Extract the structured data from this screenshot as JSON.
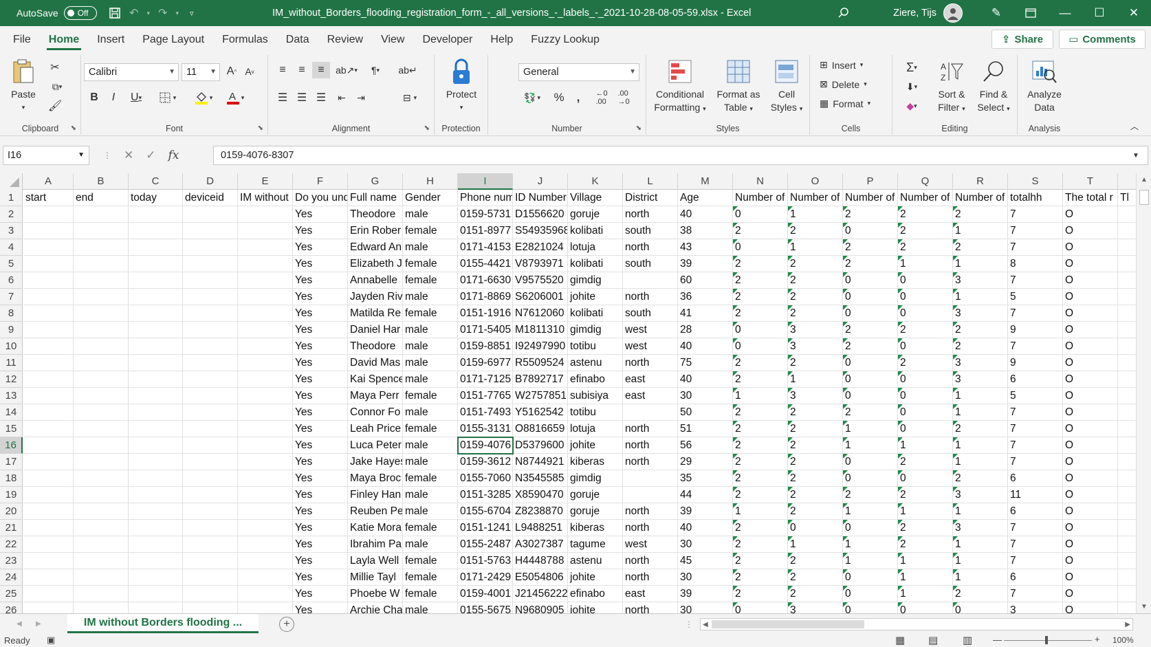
{
  "titlebar": {
    "autosave_label": "AutoSave",
    "autosave_state": "Off",
    "title": "IM_without_Borders_flooding_registration_form_-_all_versions_-_labels_-_2021-10-28-08-05-59.xlsx  -  Excel",
    "user": "Ziere, Tijs"
  },
  "tabs": [
    "File",
    "Home",
    "Insert",
    "Page Layout",
    "Formulas",
    "Data",
    "Review",
    "View",
    "Developer",
    "Help",
    "Fuzzy Lookup"
  ],
  "share_label": "Share",
  "comments_label": "Comments",
  "ribbon": {
    "clipboard": {
      "label": "Clipboard",
      "paste": "Paste"
    },
    "font": {
      "label": "Font",
      "name": "Calibri",
      "size": "11"
    },
    "alignment": {
      "label": "Alignment"
    },
    "protection": {
      "label": "Protection",
      "protect": "Protect"
    },
    "number": {
      "label": "Number",
      "format": "General"
    },
    "styles": {
      "label": "Styles",
      "conditional_1": "Conditional",
      "conditional_2": "Formatting",
      "format_table_1": "Format as",
      "format_table_2": "Table",
      "cell_styles_1": "Cell",
      "cell_styles_2": "Styles"
    },
    "cells": {
      "label": "Cells",
      "insert": "Insert",
      "delete": "Delete",
      "format": "Format"
    },
    "editing": {
      "label": "Editing",
      "sort_1": "Sort &",
      "sort_2": "Filter",
      "find_1": "Find &",
      "find_2": "Select"
    },
    "analysis": {
      "label": "Analysis",
      "analyze_1": "Analyze",
      "analyze_2": "Data"
    }
  },
  "formula_bar": {
    "name_box": "I16",
    "value": "0159-4076-8307"
  },
  "columns": [
    "A",
    "B",
    "C",
    "D",
    "E",
    "F",
    "G",
    "H",
    "I",
    "J",
    "K",
    "L",
    "M",
    "N",
    "O",
    "P",
    "Q",
    "R",
    "S",
    "T"
  ],
  "selected_column": "I",
  "selected_row": 16,
  "header_row": [
    "start",
    "end",
    "today",
    "deviceid",
    "IM without Borders flooding",
    "Do you understand",
    "Full name",
    "Gender",
    "Phone number",
    "ID Number",
    "Village",
    "District",
    "Age",
    "Number of",
    "Number of",
    "Number of",
    "Number of",
    "Number of",
    "totalhh",
    "The total r",
    "Tl"
  ],
  "rows": [
    [
      "Yes",
      "Theodore",
      "male",
      "0159-5731",
      "D1556620",
      "goruje",
      "north",
      "40",
      "0",
      "1",
      "2",
      "2",
      "2",
      "7",
      "O"
    ],
    [
      "Yes",
      "Erin Rober",
      "female",
      "0151-8977",
      "S54935968",
      "kolibati",
      "south",
      "38",
      "2",
      "2",
      "0",
      "2",
      "1",
      "7",
      "O"
    ],
    [
      "Yes",
      "Edward An",
      "male",
      "0171-4153",
      "E2821024",
      "lotuja",
      "north",
      "43",
      "0",
      "1",
      "2",
      "2",
      "2",
      "7",
      "O"
    ],
    [
      "Yes",
      "Elizabeth J",
      "female",
      "0155-4421",
      "V8793971",
      "kolibati",
      "south",
      "39",
      "2",
      "2",
      "2",
      "1",
      "1",
      "8",
      "O"
    ],
    [
      "Yes",
      "Annabelle",
      "female",
      "0171-6630",
      "V9575520",
      "gimdig",
      "",
      "60",
      "2",
      "2",
      "0",
      "0",
      "3",
      "7",
      "O"
    ],
    [
      "Yes",
      "Jayden Riv",
      "male",
      "0171-8869",
      "S6206001",
      "johite",
      "north",
      "36",
      "2",
      "2",
      "0",
      "0",
      "1",
      "5",
      "O"
    ],
    [
      "Yes",
      "Matilda Re",
      "female",
      "0151-1916",
      "N7612060",
      "kolibati",
      "south",
      "41",
      "2",
      "2",
      "0",
      "0",
      "3",
      "7",
      "O"
    ],
    [
      "Yes",
      "Daniel Har",
      "male",
      "0171-5405",
      "M1811310",
      "gimdig",
      "west",
      "28",
      "0",
      "3",
      "2",
      "2",
      "2",
      "9",
      "O"
    ],
    [
      "Yes",
      "Theodore",
      "male",
      "0159-8851",
      "I92497990",
      "totibu",
      "west",
      "40",
      "0",
      "3",
      "2",
      "0",
      "2",
      "7",
      "O"
    ],
    [
      "Yes",
      "David Mas",
      "male",
      "0159-6977",
      "R5509524",
      "astenu",
      "north",
      "75",
      "2",
      "2",
      "0",
      "2",
      "3",
      "9",
      "O"
    ],
    [
      "Yes",
      "Kai Spence",
      "male",
      "0171-7125",
      "B7892717",
      "efinabo",
      "east",
      "40",
      "2",
      "1",
      "0",
      "0",
      "3",
      "6",
      "O"
    ],
    [
      "Yes",
      "Maya Perr",
      "female",
      "0151-7765",
      "W2757851",
      "subisiya",
      "east",
      "30",
      "1",
      "3",
      "0",
      "0",
      "1",
      "5",
      "O"
    ],
    [
      "Yes",
      "Connor Fo",
      "male",
      "0151-7493",
      "Y5162542",
      "totibu",
      "",
      "50",
      "2",
      "2",
      "2",
      "0",
      "1",
      "7",
      "O"
    ],
    [
      "Yes",
      "Leah Price",
      "female",
      "0155-3131",
      "O8816659",
      "lotuja",
      "north",
      "51",
      "2",
      "2",
      "1",
      "0",
      "2",
      "7",
      "O"
    ],
    [
      "Yes",
      "Luca Peter",
      "male",
      "0159-4076",
      "D5379600",
      "johite",
      "north",
      "56",
      "2",
      "2",
      "1",
      "1",
      "1",
      "7",
      "O"
    ],
    [
      "Yes",
      "Jake Hayes",
      "male",
      "0159-3612",
      "N8744921",
      "kiberas",
      "north",
      "29",
      "2",
      "2",
      "0",
      "2",
      "1",
      "7",
      "O"
    ],
    [
      "Yes",
      "Maya Broc",
      "female",
      "0155-7060",
      "N3545585",
      "gimdig",
      "",
      "35",
      "2",
      "2",
      "0",
      "0",
      "2",
      "6",
      "O"
    ],
    [
      "Yes",
      "Finley Han",
      "male",
      "0151-3285",
      "X8590470",
      "goruje",
      "",
      "44",
      "2",
      "2",
      "2",
      "2",
      "3",
      "11",
      "O"
    ],
    [
      "Yes",
      "Reuben Pe",
      "male",
      "0155-6704",
      "Z8238870",
      "goruje",
      "north",
      "39",
      "1",
      "2",
      "1",
      "1",
      "1",
      "6",
      "O"
    ],
    [
      "Yes",
      "Katie Mora",
      "female",
      "0151-1241",
      "L9488251",
      "kiberas",
      "north",
      "40",
      "2",
      "0",
      "0",
      "2",
      "3",
      "7",
      "O"
    ],
    [
      "Yes",
      "Ibrahim Pa",
      "male",
      "0155-2487",
      "A3027387",
      "tagume",
      "west",
      "30",
      "2",
      "1",
      "1",
      "2",
      "1",
      "7",
      "O"
    ],
    [
      "Yes",
      "Layla Well",
      "female",
      "0151-5763",
      "H4448788",
      "astenu",
      "north",
      "45",
      "2",
      "2",
      "1",
      "1",
      "1",
      "7",
      "O"
    ],
    [
      "Yes",
      "Millie Tayl",
      "female",
      "0171-2429",
      "E5054806",
      "johite",
      "north",
      "30",
      "2",
      "2",
      "0",
      "1",
      "1",
      "6",
      "O"
    ],
    [
      "Yes",
      "Phoebe W",
      "female",
      "0159-4001",
      "J21456222",
      "efinabo",
      "east",
      "39",
      "2",
      "2",
      "0",
      "1",
      "2",
      "7",
      "O"
    ],
    [
      "Yes",
      "Archie Cha",
      "male",
      "0155-5675",
      "N9680905",
      "johite",
      "north",
      "30",
      "0",
      "3",
      "0",
      "0",
      "0",
      "3",
      "O"
    ]
  ],
  "sheet_tab": "IM without Borders flooding ...",
  "status": {
    "ready": "Ready",
    "zoom": "100%"
  },
  "colors": {
    "accent": "#217346",
    "header_bg": "#f3f3f3"
  }
}
